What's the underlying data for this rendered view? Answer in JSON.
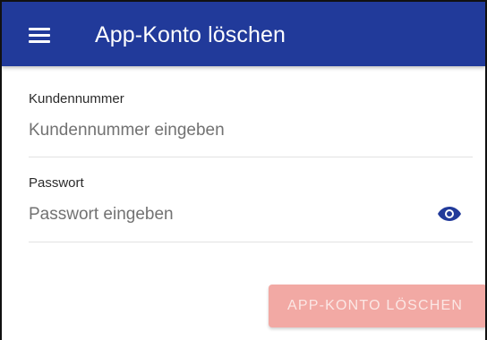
{
  "header": {
    "title": "App-Konto löschen",
    "menu_icon": "menu-icon",
    "background_color": "#213a9a"
  },
  "form": {
    "customer_number": {
      "label": "Kundennummer",
      "placeholder": "Kundennummer eingeben",
      "value": ""
    },
    "password": {
      "label": "Passwort",
      "placeholder": "Passwort eingeben",
      "value": "",
      "visibility_icon": "eye-icon",
      "icon_color": "#213a9a"
    }
  },
  "actions": {
    "delete_label": "App-Konto löschen",
    "delete_state": "disabled",
    "button_color": "#f2a9a4"
  }
}
